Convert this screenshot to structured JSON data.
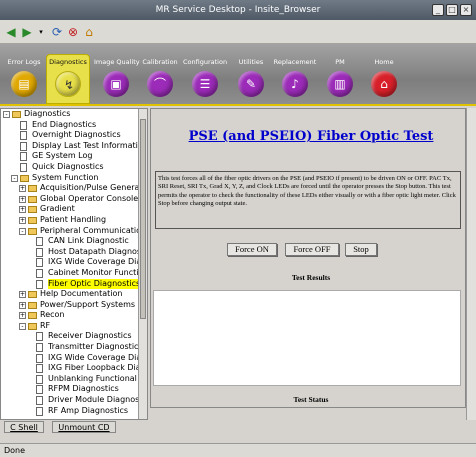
{
  "window": {
    "title": "MR Service Desktop - Insite_Browser"
  },
  "toolbar": {
    "icons": [
      "back-arrow-icon",
      "forward-arrow-icon",
      "dropdown-icon",
      "reload-icon",
      "stop-icon",
      "home-icon"
    ]
  },
  "nav": {
    "active": "Diagnostics",
    "items": [
      {
        "label": "Error Logs",
        "color": "#e0a800",
        "icon": "error-log-icon"
      },
      {
        "label": "Diagnostics",
        "color": "#e8e04a",
        "icon": "diagnostics-icon"
      },
      {
        "label": "Image Quality",
        "color": "#9b2bb8",
        "icon": "image-quality-icon"
      },
      {
        "label": "Calibration",
        "color": "#9b2bb8",
        "icon": "calibration-icon"
      },
      {
        "label": "Configuration",
        "color": "#9b2bb8",
        "icon": "configuration-icon"
      },
      {
        "label": "Utilities",
        "color": "#9b2bb8",
        "icon": "utilities-icon"
      },
      {
        "label": "Replacement",
        "color": "#9b2bb8",
        "icon": "replacement-icon"
      },
      {
        "label": "PM",
        "color": "#9b2bb8",
        "icon": "pm-icon"
      },
      {
        "label": "Home",
        "color": "#d8202a",
        "icon": "home-icon"
      }
    ]
  },
  "tree": {
    "items": [
      {
        "label": "Diagnostics",
        "level": 0,
        "type": "folder",
        "expander": "-"
      },
      {
        "label": "End Diagnostics",
        "level": 1,
        "type": "doc"
      },
      {
        "label": "Overnight Diagnostics",
        "level": 1,
        "type": "doc"
      },
      {
        "label": "Display Last Test Informatic",
        "level": 1,
        "type": "doc"
      },
      {
        "label": "GE System Log",
        "level": 1,
        "type": "doc"
      },
      {
        "label": "Quick Diagnostics",
        "level": 1,
        "type": "doc"
      },
      {
        "label": "System Function",
        "level": 1,
        "type": "folder",
        "expander": "-"
      },
      {
        "label": "Acquisition/Pulse Generat",
        "level": 2,
        "type": "folder",
        "expander": "+"
      },
      {
        "label": "Global Operator Console",
        "level": 2,
        "type": "folder",
        "expander": "+"
      },
      {
        "label": "Gradient",
        "level": 2,
        "type": "folder",
        "expander": "+"
      },
      {
        "label": "Patient Handling",
        "level": 2,
        "type": "folder",
        "expander": "+"
      },
      {
        "label": "Peripheral Communication",
        "level": 2,
        "type": "folder",
        "expander": "-"
      },
      {
        "label": "CAN Link Diagnostic",
        "level": 3,
        "type": "doc"
      },
      {
        "label": "Host Datapath Diagnost",
        "level": 3,
        "type": "doc"
      },
      {
        "label": "IXG Wide Coverage Diag",
        "level": 3,
        "type": "doc"
      },
      {
        "label": "Cabinet Monitor Functic",
        "level": 3,
        "type": "doc"
      },
      {
        "label": "Fiber Optic Diagnostics",
        "level": 3,
        "type": "doc",
        "selected": true
      },
      {
        "label": "Help Documentation",
        "level": 2,
        "type": "folder",
        "expander": "+"
      },
      {
        "label": "Power/Support Systems",
        "level": 2,
        "type": "folder",
        "expander": "+"
      },
      {
        "label": "Recon",
        "level": 2,
        "type": "folder",
        "expander": "+"
      },
      {
        "label": "RF",
        "level": 2,
        "type": "folder",
        "expander": "-"
      },
      {
        "label": "Receiver Diagnostics",
        "level": 3,
        "type": "doc"
      },
      {
        "label": "Transmitter Diagnostics",
        "level": 3,
        "type": "doc"
      },
      {
        "label": "IXG Wide Coverage Diag",
        "level": 3,
        "type": "doc"
      },
      {
        "label": "IXG Fiber Loopback Diag",
        "level": 3,
        "type": "doc"
      },
      {
        "label": "Unblanking Functional D",
        "level": 3,
        "type": "doc"
      },
      {
        "label": "RFPM Diagnostics",
        "level": 3,
        "type": "doc"
      },
      {
        "label": "Driver Module Diagnost",
        "level": 3,
        "type": "doc"
      },
      {
        "label": "RF Amp Diagnostics",
        "level": 3,
        "type": "doc"
      }
    ]
  },
  "footer_buttons": {
    "shell": "C Shell",
    "unmount": "Unmount CD"
  },
  "content": {
    "title": "PSE (and PSEIO) Fiber Optic Test",
    "description": "This test forces all of the fiber optic drivers on the PSE (and PSEIO if present) to be driven ON or OFF. PAC Tx, SRI Reset, SRI Tx, Grad X, Y, Z, and Clock LEDs are forced until the operator presses the Stop button. This test permits the operator to check the functionality of these LEDs either visually or with a fiber optic light meter. Click Stop before changing output state.",
    "buttons": {
      "force_on": "Force ON",
      "force_off": "Force OFF",
      "stop": "Stop"
    },
    "results_label": "Test Results",
    "status_label": "Test Status"
  },
  "statusbar": {
    "text": "Done"
  }
}
